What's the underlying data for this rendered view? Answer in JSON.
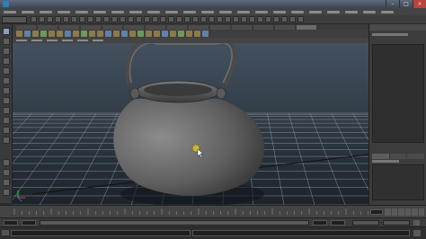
{
  "titlebar": {
    "title": ""
  },
  "window_controls": {
    "minimize": "–",
    "maximize": "□",
    "close": "×"
  },
  "menubar": {
    "item_count": 22
  },
  "channel_box": {
    "title": ""
  },
  "viewport": {
    "background_top": "#3f4d5c",
    "background_bottom": "#1f272f",
    "grid_color": "#9aa3ad"
  },
  "colors": {
    "accent": "#8aa0c0",
    "close_button": "#b8443b",
    "shelf_icon": "#8c7b4a"
  }
}
